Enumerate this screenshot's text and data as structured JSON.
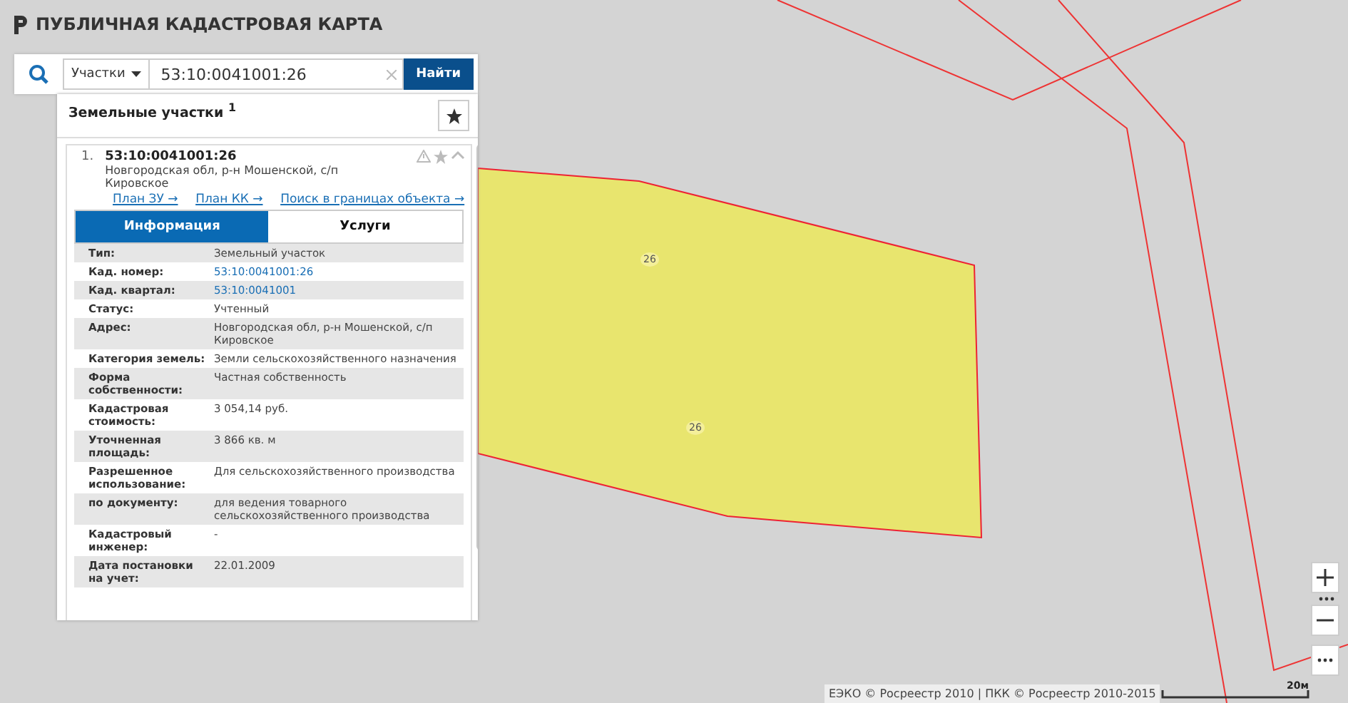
{
  "app": {
    "title": "ПУБЛИЧНАЯ КАДАСТРОВАЯ КАРТА"
  },
  "search": {
    "category": "Участки",
    "value": "53:10:0041001:26",
    "button": "Найти"
  },
  "results": {
    "title": "Земельные участки",
    "count": "1",
    "item": {
      "index": "1.",
      "number": "53:10:0041001:26",
      "address": "Новгородская обл, р-н Мошенской, с/п Кировское",
      "links": [
        "План ЗУ →",
        "План КК →",
        "Поиск в границах объекта →"
      ],
      "tabs": [
        {
          "label": "Информация",
          "selected": true
        },
        {
          "label": "Услуги",
          "selected": false
        }
      ],
      "rows": [
        {
          "label": "Тип:",
          "value": "Земельный участок",
          "kind": "text"
        },
        {
          "label": "Кад. номер:",
          "value": "53:10:0041001:26",
          "kind": "link"
        },
        {
          "label": "Кад. квартал:",
          "value": "53:10:0041001",
          "kind": "link"
        },
        {
          "label": "Статус:",
          "value": "Учтенный",
          "kind": "text"
        },
        {
          "label": "Адрес:",
          "value": "Новгородская обл, р-н Мошенской, с/п Кировское",
          "kind": "text"
        },
        {
          "label": "Категория земель:",
          "value": "Земли сельскохозяйственного назначения",
          "kind": "text"
        },
        {
          "label": "Форма собственности:",
          "value": "Частная собственность",
          "kind": "text"
        },
        {
          "label": "Кадастровая стоимость:",
          "value": "3 054,14 руб.",
          "kind": "text"
        },
        {
          "label": "Уточненная площадь:",
          "value": "3 866 кв. м",
          "kind": "text"
        },
        {
          "label": "Разрешенное использование:",
          "value": "Для сельскохозяйственного производства",
          "kind": "text"
        },
        {
          "label": "по документу:",
          "value": "для ведения товарного сельскохозяйственного производства",
          "kind": "text"
        },
        {
          "label": "Кадастровый инженер:",
          "value": "-",
          "kind": "text"
        },
        {
          "label": "Дата постановки на учет:",
          "value": "22.01.2009",
          "kind": "text"
        }
      ]
    }
  },
  "map": {
    "parcel_labels": [
      "26",
      "26"
    ],
    "attribution": "ЕЭКО © Росреестр 2010 | ПКК © Росреестр 2010-2015",
    "scale": "20м"
  }
}
